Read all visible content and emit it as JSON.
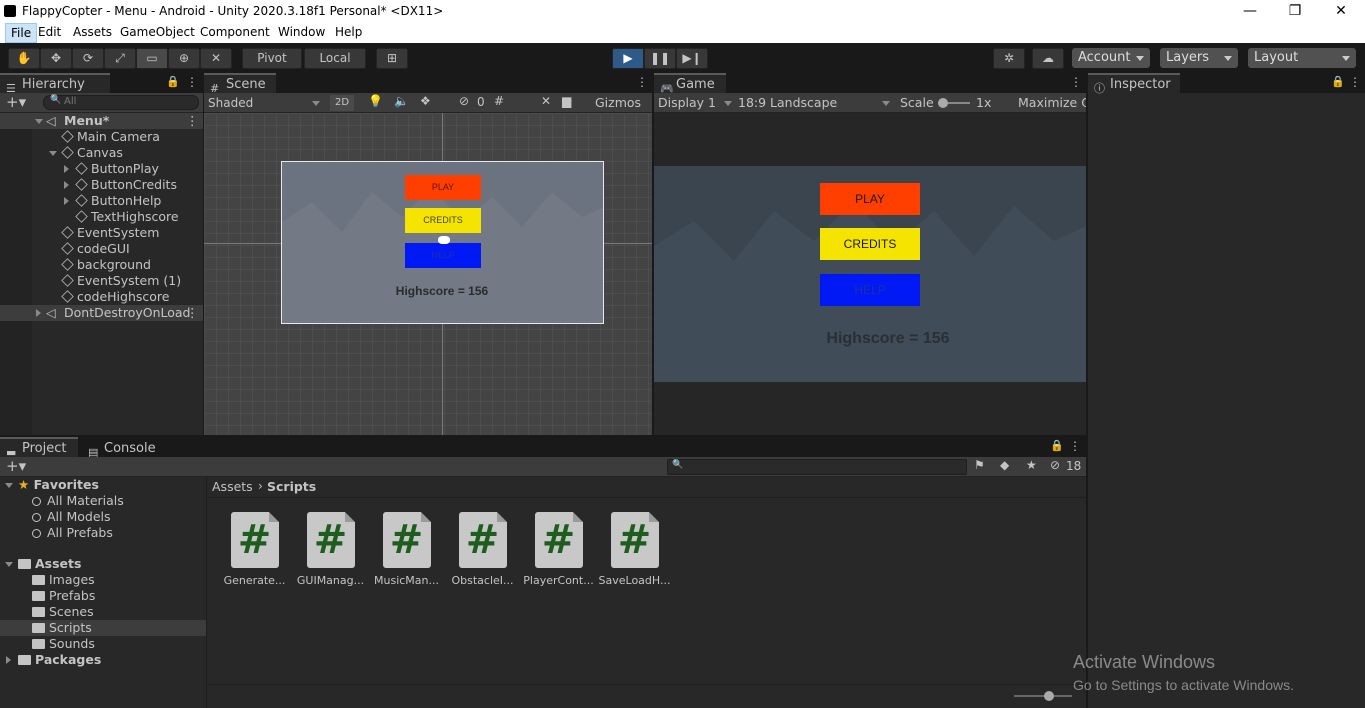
{
  "window": {
    "title": "FlappyCopter - Menu - Android - Unity 2020.3.18f1 Personal* <DX11>",
    "minimize": "—",
    "maximize": "❐",
    "close": "✕"
  },
  "menu": [
    "File",
    "Edit",
    "Assets",
    "GameObject",
    "Component",
    "Window",
    "Help"
  ],
  "toolbar": {
    "pivot": "Pivot",
    "local": "Local",
    "account": "Account",
    "layers": "Layers",
    "layout": "Layout"
  },
  "hierarchy": {
    "tab": "Hierarchy",
    "search_placeholder": "All",
    "scene": "Menu*",
    "items": [
      "Main Camera",
      "Canvas",
      "ButtonPlay",
      "ButtonCredits",
      "ButtonHelp",
      "TextHighscore",
      "EventSystem",
      "codeGUI",
      "background",
      "EventSystem (1)",
      "codeHighscore"
    ],
    "dontdestroy": "DontDestroyOnLoad"
  },
  "scene": {
    "tab": "Scene",
    "shading": "Shaded",
    "mode2d": "2D",
    "hidden_count": "0",
    "gizmos": "Gizmos",
    "play": "PLAY",
    "credits": "CREDITS",
    "help": "HELP",
    "highscore": "Highscore = 156"
  },
  "game": {
    "tab": "Game",
    "display": "Display 1",
    "aspect": "18:9 Landscape",
    "scale_label": "Scale",
    "scale_value": "1x",
    "maximize": "Maximize O",
    "play": "PLAY",
    "credits": "CREDITS",
    "help": "HELP",
    "highscore": "Highscore = 156"
  },
  "inspector": {
    "tab": "Inspector"
  },
  "project": {
    "tab": "Project",
    "console_tab": "Console",
    "hidden_count": "18",
    "favorites": "Favorites",
    "fav_items": [
      "All Materials",
      "All Models",
      "All Prefabs"
    ],
    "assets": "Assets",
    "asset_folders": [
      "Images",
      "Prefabs",
      "Scenes",
      "Scripts",
      "Sounds"
    ],
    "packages": "Packages",
    "breadcrumb_root": "Assets",
    "breadcrumb_current": "Scripts",
    "files": [
      "Generate...",
      "GUIManag...",
      "MusicMan...",
      "ObstacleI...",
      "PlayerCont...",
      "SaveLoadH..."
    ],
    "file_glyph": "#"
  },
  "watermark": {
    "line1": "Activate Windows",
    "line2": "Go to Settings to activate Windows."
  },
  "colors": {
    "play": "#ff3f00",
    "credits": "#f5e400",
    "help": "#0019f5",
    "accent": "#2d5a88"
  }
}
